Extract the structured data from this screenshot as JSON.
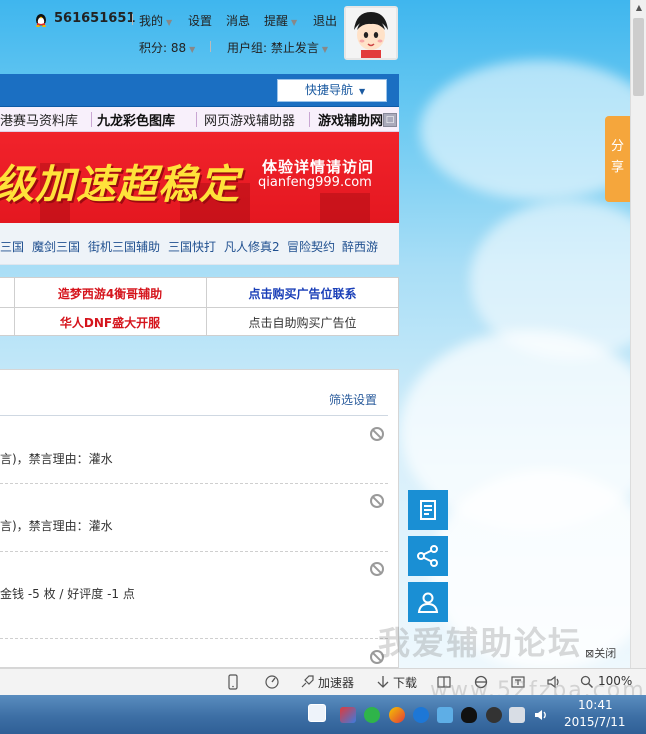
{
  "user": {
    "qq_number": "561651651",
    "menu": [
      "我的",
      "设置",
      "消息",
      "提醒",
      "退出"
    ],
    "points_label": "积分: 88",
    "group_label": "用户组: 禁止发言"
  },
  "nav": {
    "quick_nav": "快捷导航"
  },
  "link_bar": [
    "港赛马资料库",
    "九龙彩色图库",
    "网页游戏辅助器",
    "游戏辅助网"
  ],
  "banner": {
    "headline": "级加速超稳定",
    "line1": "体验详情请访问",
    "line2": "qianfeng999.com"
  },
  "game_links": [
    "三国",
    "魔剑三国",
    "街机三国辅助",
    "三国快打",
    "凡人修真2",
    "冒险契约",
    "醉西游"
  ],
  "ads": {
    "r1c1": "造梦西游4衡哥辅助",
    "r1c2": "点击购买广告位联系",
    "r2c1": "华人DNF盛大开服",
    "r2c2": "点击自助购买广告位"
  },
  "panel": {
    "filter": "筛选设置",
    "notices": [
      "言)，禁言理由：灌水",
      "言)，禁言理由：灌水",
      "金钱 -5 枚 / 好评度 -1 点"
    ]
  },
  "share_tab": [
    "分",
    "享"
  ],
  "watermark": "我爱辅助论坛",
  "close_ad": "关闭",
  "status_bar": {
    "accelerator": "加速器",
    "download": "下载",
    "zoom": "100%",
    "site_watermark": "www.52fzba.com"
  },
  "clock": {
    "time": "10:41",
    "date": "2015/7/11"
  },
  "colors": {
    "nav_blue": "#1b6fc2",
    "banner_red": "#e41720",
    "ad_red": "#d5141c",
    "ad_blue": "#1a3fb8",
    "float_blue": "#1a8fd4",
    "share_orange": "#f5a63c"
  }
}
